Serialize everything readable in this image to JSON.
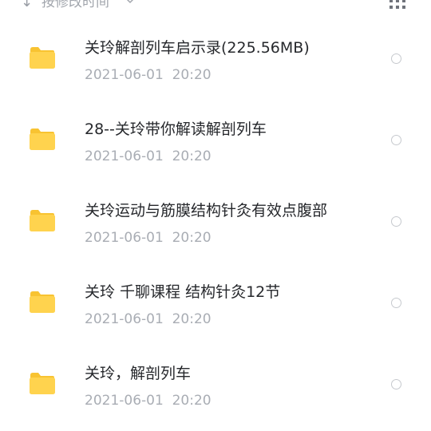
{
  "toolbar": {
    "sort_arrow_icon": "arrow-down-icon",
    "sort_label": "按修改时间",
    "chevron_icon": "chevron-down-icon",
    "view_icon": "grid-view-icon"
  },
  "colors": {
    "folder": "#FFD34E",
    "folder_tab": "#F8C331",
    "title": "#26282C",
    "meta": "#A9ADB4"
  },
  "files": [
    {
      "name": "关玲解剖列车启示录(225.56MB)",
      "date": "2021-06-01  20:20",
      "icon": "folder-icon"
    },
    {
      "name": "28--关玲带你解读解剖列车",
      "date": "2021-06-01  20:20",
      "icon": "folder-icon"
    },
    {
      "name": "关玲运动与筋膜结构针灸有效点腹部",
      "date": "2021-06-01  20:20",
      "icon": "folder-icon"
    },
    {
      "name": "关玲 千聊课程 结构针灸12节",
      "date": "2021-06-01  20:20",
      "icon": "folder-icon"
    },
    {
      "name": "关玲，解剖列车",
      "date": "2021-06-01  20:20",
      "icon": "folder-icon"
    }
  ]
}
